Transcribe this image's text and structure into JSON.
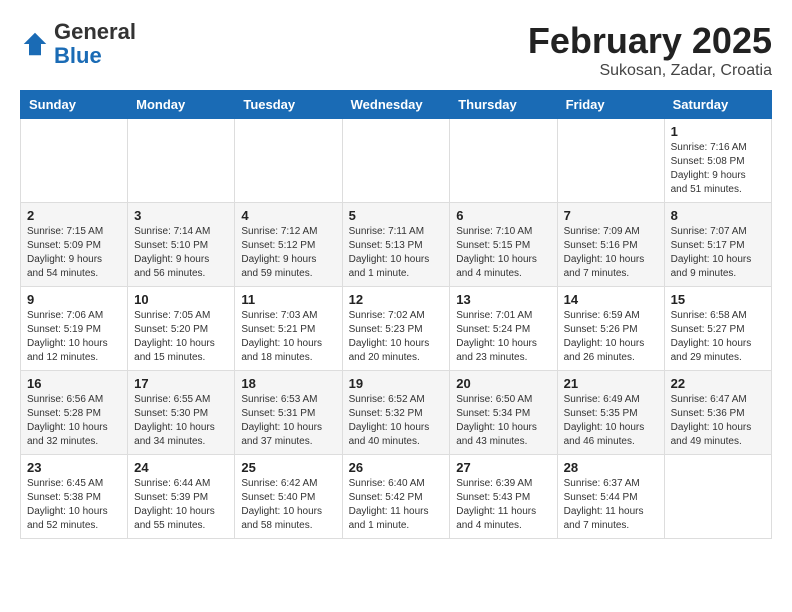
{
  "header": {
    "logo_general": "General",
    "logo_blue": "Blue",
    "title": "February 2025",
    "subtitle": "Sukosan, Zadar, Croatia"
  },
  "weekdays": [
    "Sunday",
    "Monday",
    "Tuesday",
    "Wednesday",
    "Thursday",
    "Friday",
    "Saturday"
  ],
  "weeks": [
    [
      {
        "day": "",
        "info": ""
      },
      {
        "day": "",
        "info": ""
      },
      {
        "day": "",
        "info": ""
      },
      {
        "day": "",
        "info": ""
      },
      {
        "day": "",
        "info": ""
      },
      {
        "day": "",
        "info": ""
      },
      {
        "day": "1",
        "info": "Sunrise: 7:16 AM\nSunset: 5:08 PM\nDaylight: 9 hours and 51 minutes."
      }
    ],
    [
      {
        "day": "2",
        "info": "Sunrise: 7:15 AM\nSunset: 5:09 PM\nDaylight: 9 hours and 54 minutes."
      },
      {
        "day": "3",
        "info": "Sunrise: 7:14 AM\nSunset: 5:10 PM\nDaylight: 9 hours and 56 minutes."
      },
      {
        "day": "4",
        "info": "Sunrise: 7:12 AM\nSunset: 5:12 PM\nDaylight: 9 hours and 59 minutes."
      },
      {
        "day": "5",
        "info": "Sunrise: 7:11 AM\nSunset: 5:13 PM\nDaylight: 10 hours and 1 minute."
      },
      {
        "day": "6",
        "info": "Sunrise: 7:10 AM\nSunset: 5:15 PM\nDaylight: 10 hours and 4 minutes."
      },
      {
        "day": "7",
        "info": "Sunrise: 7:09 AM\nSunset: 5:16 PM\nDaylight: 10 hours and 7 minutes."
      },
      {
        "day": "8",
        "info": "Sunrise: 7:07 AM\nSunset: 5:17 PM\nDaylight: 10 hours and 9 minutes."
      }
    ],
    [
      {
        "day": "9",
        "info": "Sunrise: 7:06 AM\nSunset: 5:19 PM\nDaylight: 10 hours and 12 minutes."
      },
      {
        "day": "10",
        "info": "Sunrise: 7:05 AM\nSunset: 5:20 PM\nDaylight: 10 hours and 15 minutes."
      },
      {
        "day": "11",
        "info": "Sunrise: 7:03 AM\nSunset: 5:21 PM\nDaylight: 10 hours and 18 minutes."
      },
      {
        "day": "12",
        "info": "Sunrise: 7:02 AM\nSunset: 5:23 PM\nDaylight: 10 hours and 20 minutes."
      },
      {
        "day": "13",
        "info": "Sunrise: 7:01 AM\nSunset: 5:24 PM\nDaylight: 10 hours and 23 minutes."
      },
      {
        "day": "14",
        "info": "Sunrise: 6:59 AM\nSunset: 5:26 PM\nDaylight: 10 hours and 26 minutes."
      },
      {
        "day": "15",
        "info": "Sunrise: 6:58 AM\nSunset: 5:27 PM\nDaylight: 10 hours and 29 minutes."
      }
    ],
    [
      {
        "day": "16",
        "info": "Sunrise: 6:56 AM\nSunset: 5:28 PM\nDaylight: 10 hours and 32 minutes."
      },
      {
        "day": "17",
        "info": "Sunrise: 6:55 AM\nSunset: 5:30 PM\nDaylight: 10 hours and 34 minutes."
      },
      {
        "day": "18",
        "info": "Sunrise: 6:53 AM\nSunset: 5:31 PM\nDaylight: 10 hours and 37 minutes."
      },
      {
        "day": "19",
        "info": "Sunrise: 6:52 AM\nSunset: 5:32 PM\nDaylight: 10 hours and 40 minutes."
      },
      {
        "day": "20",
        "info": "Sunrise: 6:50 AM\nSunset: 5:34 PM\nDaylight: 10 hours and 43 minutes."
      },
      {
        "day": "21",
        "info": "Sunrise: 6:49 AM\nSunset: 5:35 PM\nDaylight: 10 hours and 46 minutes."
      },
      {
        "day": "22",
        "info": "Sunrise: 6:47 AM\nSunset: 5:36 PM\nDaylight: 10 hours and 49 minutes."
      }
    ],
    [
      {
        "day": "23",
        "info": "Sunrise: 6:45 AM\nSunset: 5:38 PM\nDaylight: 10 hours and 52 minutes."
      },
      {
        "day": "24",
        "info": "Sunrise: 6:44 AM\nSunset: 5:39 PM\nDaylight: 10 hours and 55 minutes."
      },
      {
        "day": "25",
        "info": "Sunrise: 6:42 AM\nSunset: 5:40 PM\nDaylight: 10 hours and 58 minutes."
      },
      {
        "day": "26",
        "info": "Sunrise: 6:40 AM\nSunset: 5:42 PM\nDaylight: 11 hours and 1 minute."
      },
      {
        "day": "27",
        "info": "Sunrise: 6:39 AM\nSunset: 5:43 PM\nDaylight: 11 hours and 4 minutes."
      },
      {
        "day": "28",
        "info": "Sunrise: 6:37 AM\nSunset: 5:44 PM\nDaylight: 11 hours and 7 minutes."
      },
      {
        "day": "",
        "info": ""
      }
    ]
  ]
}
